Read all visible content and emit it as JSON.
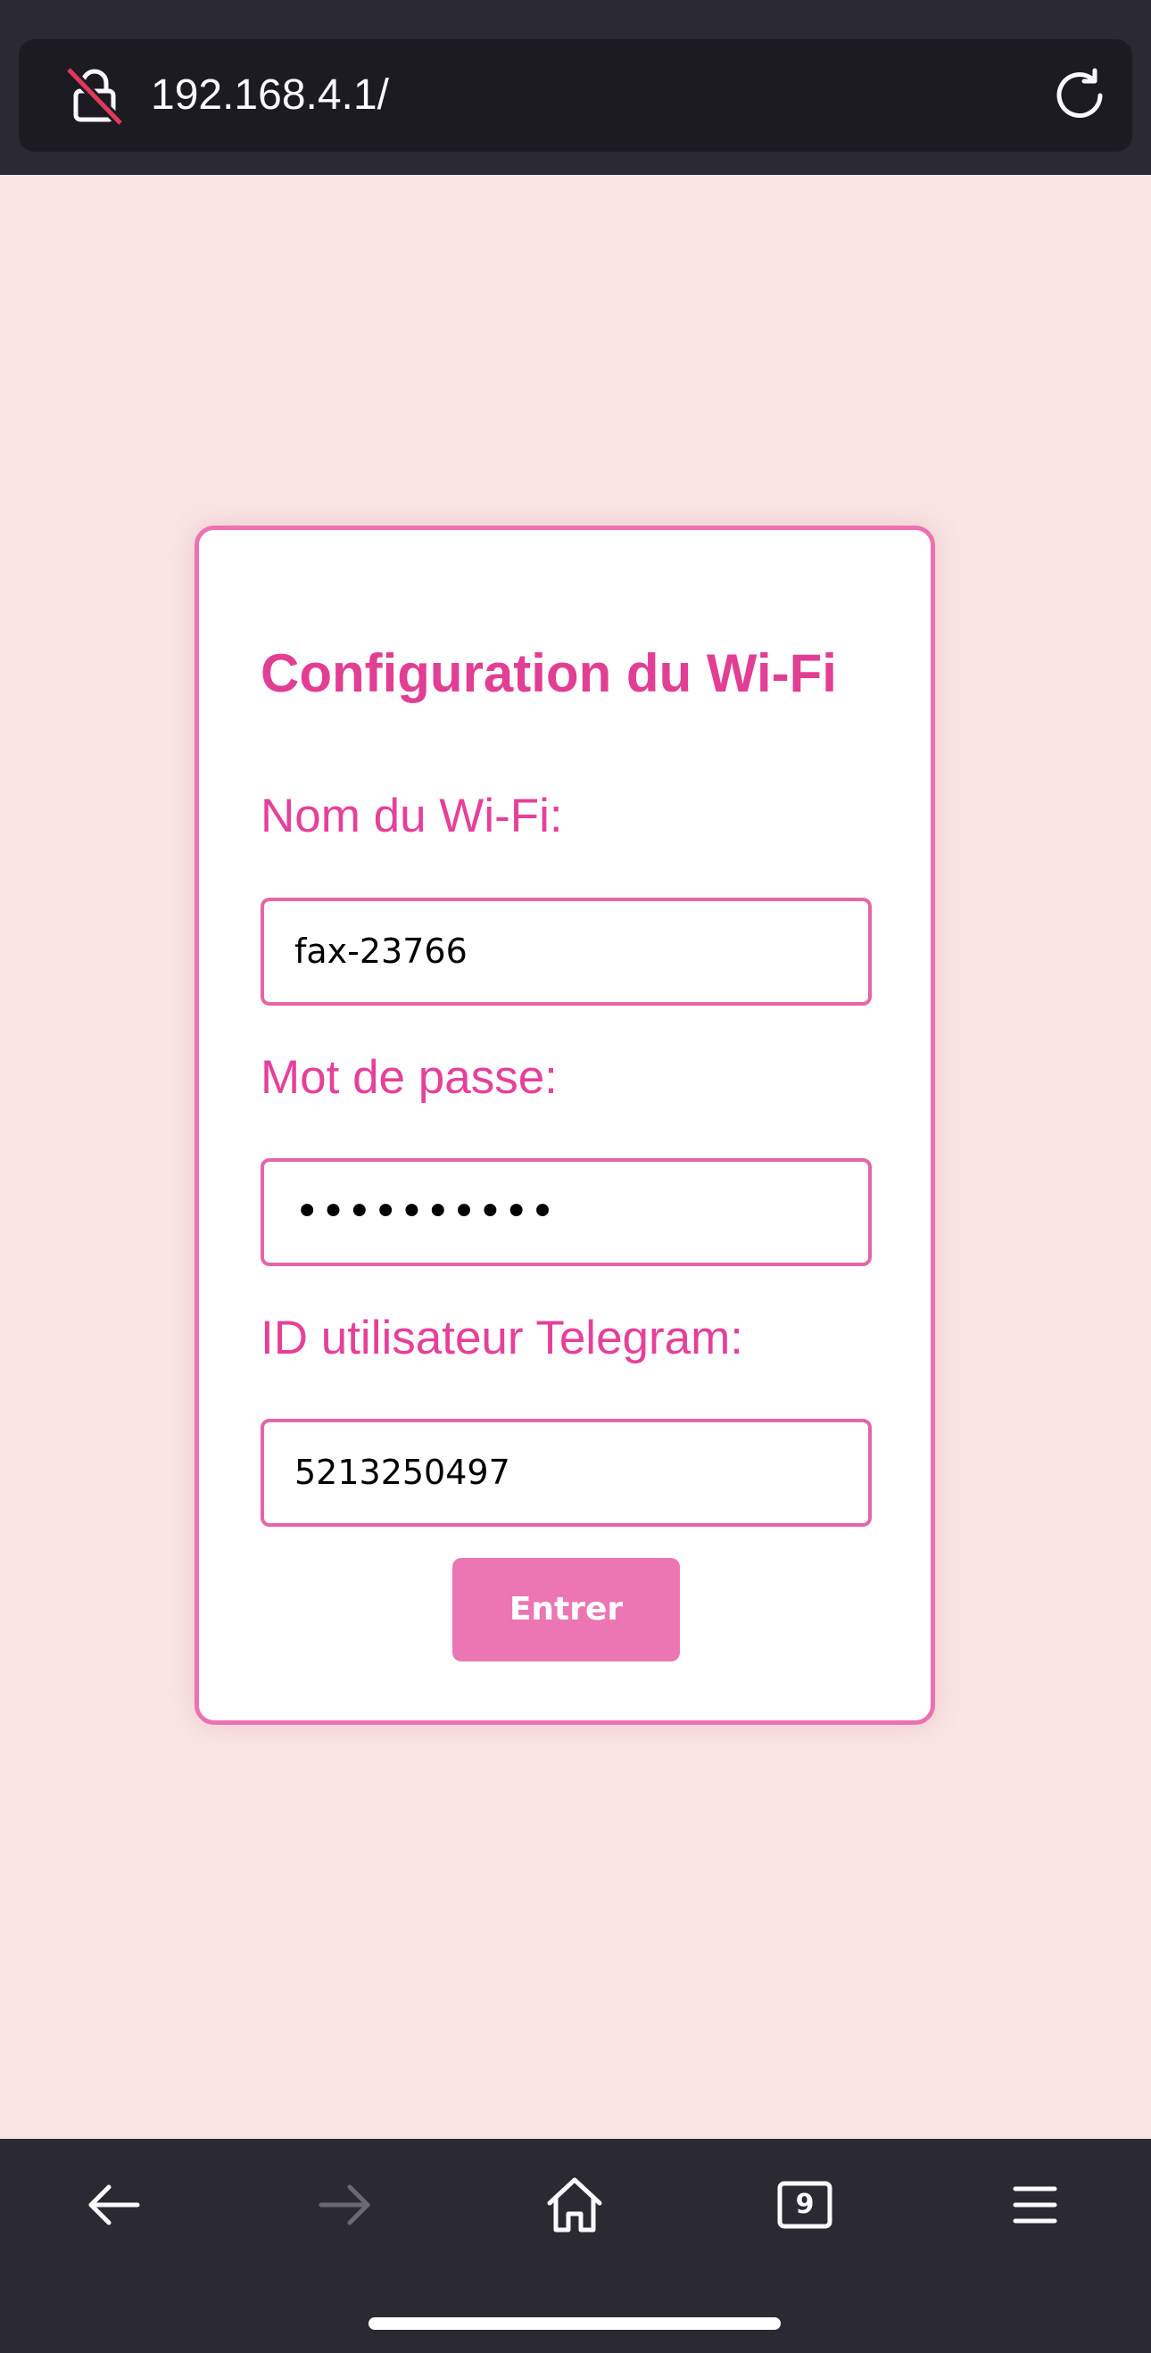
{
  "browser": {
    "url": "192.168.4.1/",
    "icons": {
      "security": "insecure-lock-icon",
      "reload": "reload-icon"
    }
  },
  "form": {
    "title": "Configuration du Wi-Fi",
    "wifi_name_label": "Nom du Wi-Fi:",
    "wifi_name_value": "fax-23766",
    "password_label": "Mot de passe:",
    "password_value": "••••••••••",
    "telegram_label": "ID utilisateur Telegram:",
    "telegram_value": "5213250497",
    "submit_label": "Entrer"
  },
  "toolbar": {
    "tab_count": "9",
    "icons": [
      "back-arrow-icon",
      "forward-arrow-icon",
      "home-icon",
      "tabs-icon",
      "menu-icon"
    ]
  },
  "colors": {
    "accent": "#e23e93",
    "button": "#ec76b3",
    "page_background": "#f8e4e3",
    "chrome": "#2b2a33"
  }
}
